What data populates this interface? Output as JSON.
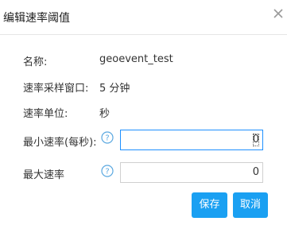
{
  "dialog": {
    "title": "编辑速率阈值"
  },
  "form": {
    "name_label": "名称:",
    "name_value": "geoevent_test",
    "window_label": "速率采样窗口:",
    "window_value": "5 分钟",
    "unit_label": "速率单位:",
    "unit_value": "秒",
    "min_label": "最小速率(每秒):",
    "min_value": "0",
    "max_label": "最大速率",
    "max_value": "0"
  },
  "buttons": {
    "save_label": "保存",
    "cancel_label": "取消"
  },
  "icons": {
    "close": "close-icon",
    "help": "question-circle-icon"
  },
  "colors": {
    "primary": "#1aa0f2",
    "help_icon": "#5aa8e0",
    "focus_border": "#1e90ff"
  }
}
